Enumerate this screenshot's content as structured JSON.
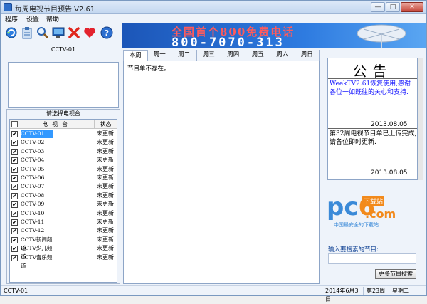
{
  "window": {
    "title": "每周电视节目预告 V2.61",
    "min": "—",
    "max": "□",
    "close": "✕"
  },
  "menu": [
    "程序",
    "设置",
    "帮助"
  ],
  "toolbar": [
    "refresh-icon",
    "clipboard-icon",
    "search-icon",
    "monitor-icon",
    "delete-icon",
    "heart-icon",
    "help-icon"
  ],
  "banner": {
    "line1": "全国首个800免费电话",
    "line2": "800-7070-313"
  },
  "channel": {
    "current": "CCTV-01"
  },
  "channel_group": {
    "title": "请选择电视台",
    "col_name": "电视台",
    "col_status": "状态",
    "rows": [
      {
        "name": "CCTV-01",
        "status": "未更新"
      },
      {
        "name": "CCTV-02",
        "status": "未更新"
      },
      {
        "name": "CCTV-03",
        "status": "未更新"
      },
      {
        "name": "CCTV-04",
        "status": "未更新"
      },
      {
        "name": "CCTV-05",
        "status": "未更新"
      },
      {
        "name": "CCTV-06",
        "status": "未更新"
      },
      {
        "name": "CCTV-07",
        "status": "未更新"
      },
      {
        "name": "CCTV-08",
        "status": "未更新"
      },
      {
        "name": "CCTV-09",
        "status": "未更新"
      },
      {
        "name": "CCTV-10",
        "status": "未更新"
      },
      {
        "name": "CCTV-11",
        "status": "未更新"
      },
      {
        "name": "CCTV-12",
        "status": "未更新"
      },
      {
        "name": "CCTV新闻频道",
        "status": "未更新"
      },
      {
        "name": "CCTV少儿频道",
        "status": "未更新"
      },
      {
        "name": "CCTV音乐频道",
        "status": "未更新"
      }
    ]
  },
  "tabs": [
    "本周",
    "周一",
    "周二",
    "周三",
    "周四",
    "周五",
    "周六",
    "周日"
  ],
  "schedule": {
    "text": "节目单不存在。"
  },
  "notice": {
    "title": "公告",
    "item1": "WeekTV2.61恢复使用,感谢各位一如既往的关心和支持.",
    "date1": "2013.08.05",
    "item2": "第32周电视节目单已上传完成,请各位即时更新.",
    "date2": "2013.08.05"
  },
  "logo": {
    "p": "pc",
    "six": "6",
    "badge": "下载站",
    "com": ".com",
    "slogan": "中国最安全的下载站"
  },
  "search": {
    "label": "输入要搜索的节目:",
    "value": "",
    "button": "更多节目搜索"
  },
  "status": {
    "channel": "CCTV-01",
    "date": "2014年6月3日",
    "week": "第23周",
    "weekday": "星期二"
  },
  "colors": {
    "selected": "#3399ff",
    "notice_blue": "#1a1aff",
    "banner_red": "#ff5b5b"
  }
}
